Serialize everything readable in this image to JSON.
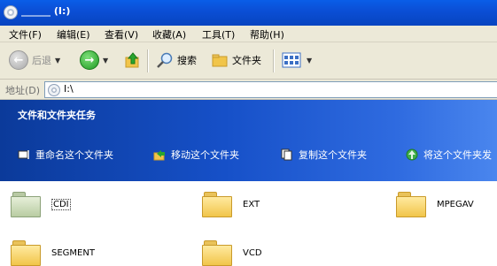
{
  "window": {
    "title": "______ (I:)"
  },
  "menu": [
    "文件(F)",
    "编辑(E)",
    "查看(V)",
    "收藏(A)",
    "工具(T)",
    "帮助(H)"
  ],
  "toolbar": {
    "back": "后退",
    "search": "搜索",
    "folders": "文件夹"
  },
  "address": {
    "label": "地址(D)",
    "value": "I:\\"
  },
  "tasks": {
    "title": "文件和文件夹任务",
    "items": [
      "重命名这个文件夹",
      "移动这个文件夹",
      "复制这个文件夹",
      "将这个文件夹发"
    ]
  },
  "folders": [
    "CDI",
    "EXT",
    "MPEGAV",
    "SEGMENT",
    "VCD"
  ]
}
